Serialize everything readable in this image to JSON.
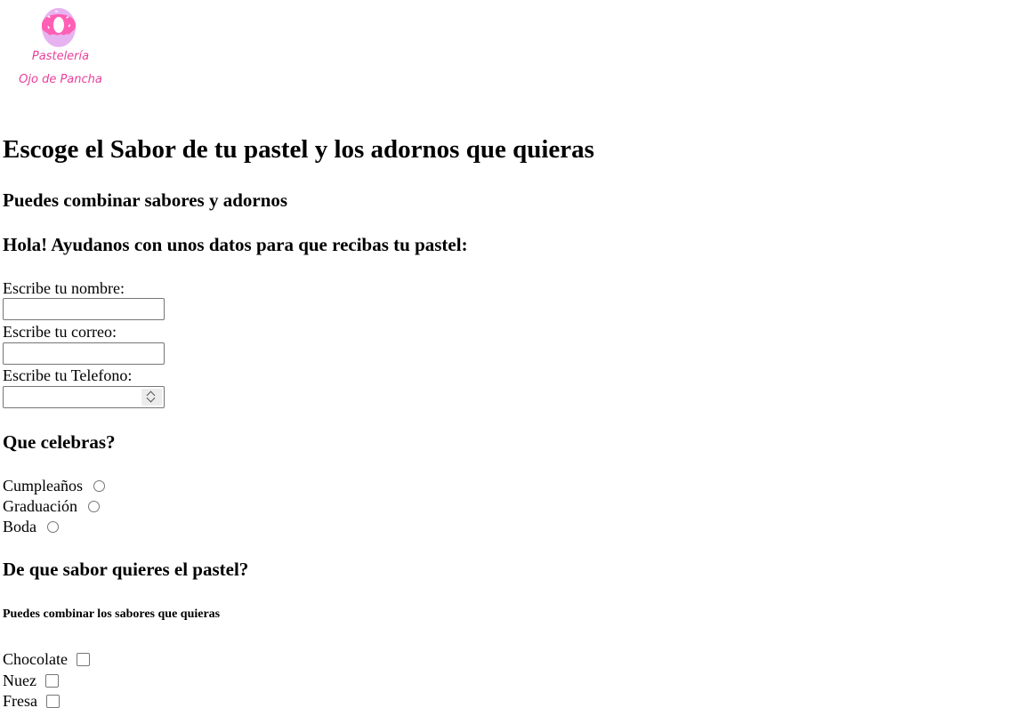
{
  "logo": {
    "icon": "donut-icon",
    "line1": "Pastelería",
    "line2": "Ojo de Pancha",
    "colors": {
      "frosting": "#ff5fb4",
      "dough": "#e6b3f0",
      "text": "#e8409b"
    }
  },
  "headings": {
    "title": "Escoge el Sabor de tu pastel y los adornos que quieras",
    "subtitle": "Puedes combinar sabores y adornos",
    "data_prompt": "Hola! Ayudanos con unos datos para que recibas tu pastel:"
  },
  "form": {
    "name_label": "Escribe tu nombre:",
    "name_value": "",
    "email_label": "Escribe tu correo:",
    "email_value": "",
    "phone_label": "Escribe tu Telefono:",
    "phone_value": ""
  },
  "celebration": {
    "heading": "Que celebras?",
    "options": [
      "Cumpleaños",
      "Graduación",
      "Boda"
    ]
  },
  "flavor": {
    "heading": "De que sabor quieres el pastel?",
    "note": "Puedes combinar los sabores que quieras",
    "options": [
      "Chocolate",
      "Nuez",
      "Fresa"
    ]
  }
}
